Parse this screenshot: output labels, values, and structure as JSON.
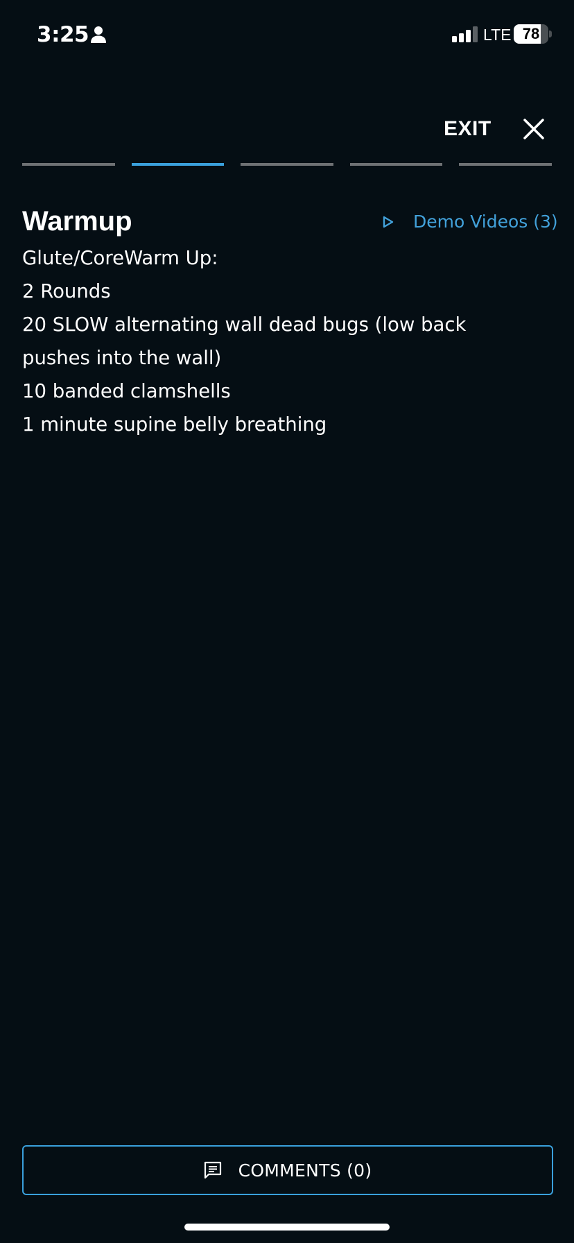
{
  "status_bar": {
    "time": "3:25",
    "network": "LTE",
    "battery_level": "78",
    "battery_fraction": 0.78
  },
  "header": {
    "exit_label": "EXIT"
  },
  "progress": {
    "total_steps": 5,
    "current_step": 2
  },
  "section": {
    "title": "Warmup",
    "demo_videos_label": "Demo Videos (3)",
    "lines": [
      "Glute/CoreWarm Up:",
      "2 Rounds",
      "20 SLOW alternating wall dead bugs (low back pushes into the wall)",
      "10 banded clamshells",
      "1 minute supine belly breathing"
    ]
  },
  "footer": {
    "comments_label": "COMMENTS (0)"
  },
  "icons": {
    "person": "person-icon",
    "signal": "cellular-signal-icon",
    "close": "close-icon",
    "play": "play-icon",
    "comment": "comment-icon"
  },
  "colors": {
    "background": "#050e14",
    "accent": "#3aa0dc",
    "link": "#42a1da",
    "inactive_step": "#6e7174",
    "text": "#ffffff"
  }
}
